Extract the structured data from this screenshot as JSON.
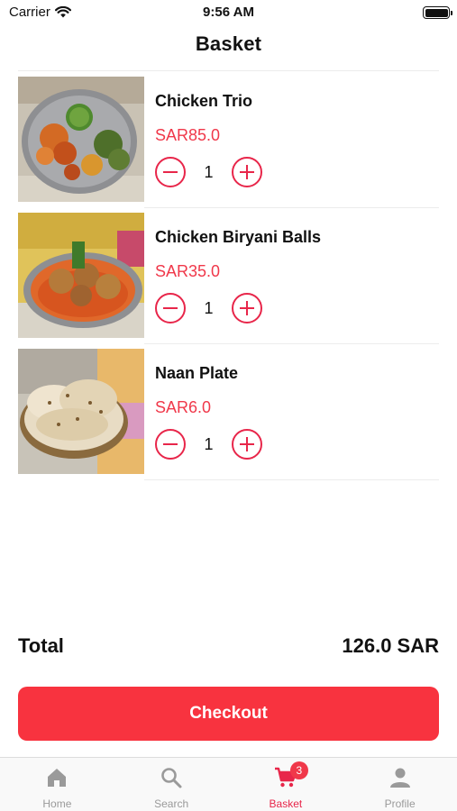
{
  "status_bar": {
    "carrier": "Carrier",
    "time": "9:56 AM"
  },
  "header": {
    "title": "Basket"
  },
  "items": [
    {
      "name": "Chicken Trio",
      "price": "SAR85.0",
      "quantity": "1"
    },
    {
      "name": "Chicken Biryani Balls",
      "price": "SAR35.0",
      "quantity": "1"
    },
    {
      "name": "Naan Plate",
      "price": "SAR6.0",
      "quantity": "1"
    }
  ],
  "summary": {
    "total_label": "Total",
    "total_value": "126.0 SAR"
  },
  "checkout": {
    "label": "Checkout"
  },
  "tabbar": {
    "tabs": [
      {
        "label": "Home",
        "icon": "home-icon"
      },
      {
        "label": "Search",
        "icon": "search-icon"
      },
      {
        "label": "Basket",
        "icon": "cart-icon",
        "badge": "3"
      },
      {
        "label": "Profile",
        "icon": "person-icon"
      }
    ],
    "active": "Basket"
  },
  "colors": {
    "accent": "#e8264a",
    "price": "#f0384a",
    "checkout": "#f8333f",
    "tab_inactive": "#9a9a9a"
  }
}
